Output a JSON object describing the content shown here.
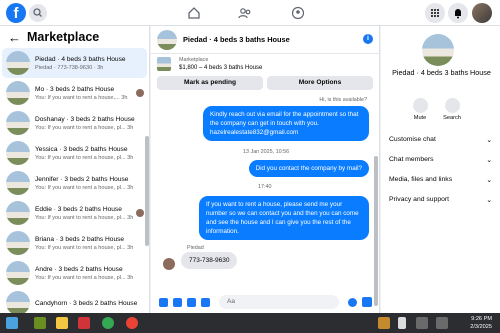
{
  "header": {
    "logo": "f",
    "icons": [
      "home-icon",
      "friends-icon",
      "groups-icon"
    ],
    "right_icons": [
      "menu-grid-icon",
      "messenger-icon",
      "notifications-icon",
      "profile-avatar"
    ]
  },
  "sidebar": {
    "title": "Marketplace",
    "back_icon": "←",
    "conversations": [
      {
        "name": "Piedad · 4 beds 3 baths House",
        "preview": "Piedad · 773-738-9630 · 3h",
        "time": "",
        "active": true
      },
      {
        "name": "Mo · 3 beds 2 baths House",
        "preview": "You: If you want to rent a house,...",
        "time": "3h",
        "active": false
      },
      {
        "name": "Doshanay · 3 beds 2 baths House",
        "preview": "You: If you want to rent a house, pl...",
        "time": "3h",
        "active": false
      },
      {
        "name": "Yessica · 3 beds 2 baths House",
        "preview": "You: If you want to rent a house, pl...",
        "time": "3h",
        "active": false
      },
      {
        "name": "Jennifer · 3 beds 2 baths House",
        "preview": "You: If you want to rent a house, pl...",
        "time": "3h",
        "active": false
      },
      {
        "name": "Eddie · 3 beds 2 baths House",
        "preview": "You: If you want to rent a house, pl...",
        "time": "3h",
        "active": false
      },
      {
        "name": "Briana · 3 beds 2 baths House",
        "preview": "You: If you want to rent a house, pl...",
        "time": "3h",
        "active": false
      },
      {
        "name": "Andre · 3 beds 2 baths House",
        "preview": "You: If you want to rent a house, pl...",
        "time": "3h",
        "active": false
      },
      {
        "name": "Candyhorn · 3 beds 2 baths House",
        "preview": "",
        "time": "",
        "active": false
      }
    ]
  },
  "chat": {
    "title": "Piedad · 4 beds 3 baths House",
    "listing_label": "Marketplace",
    "listing_text": "$1,800 – 4 beds 3 baths House",
    "mark_pending": "Mark as pending",
    "more_options": "More Options",
    "intro": "Hi, is this available?",
    "msg1": "Kindly reach out via email for the appointment so that the company can get in touch with you. hazelrealestate832@gmail.com",
    "date": "13 Jan 2025, 10:56",
    "msg2": "Did you contact the company by mail?",
    "time2": "17:40",
    "msg3": "If you want to rent a house, please send me your number so we can contact you and then you can come and see the house and I can give you the rest of the information.",
    "sender": "Piedad",
    "reply": "773-738-9630",
    "composer_placeholder": "Aa"
  },
  "details": {
    "title": "Piedad · 4 beds 3 baths House",
    "mute": "Mute",
    "search": "Search",
    "rows": [
      "Customise chat",
      "Chat members",
      "Media, files and links",
      "Privacy and support"
    ]
  },
  "taskbar": {
    "time": "9:26 PM",
    "date": "2/3/2025"
  }
}
